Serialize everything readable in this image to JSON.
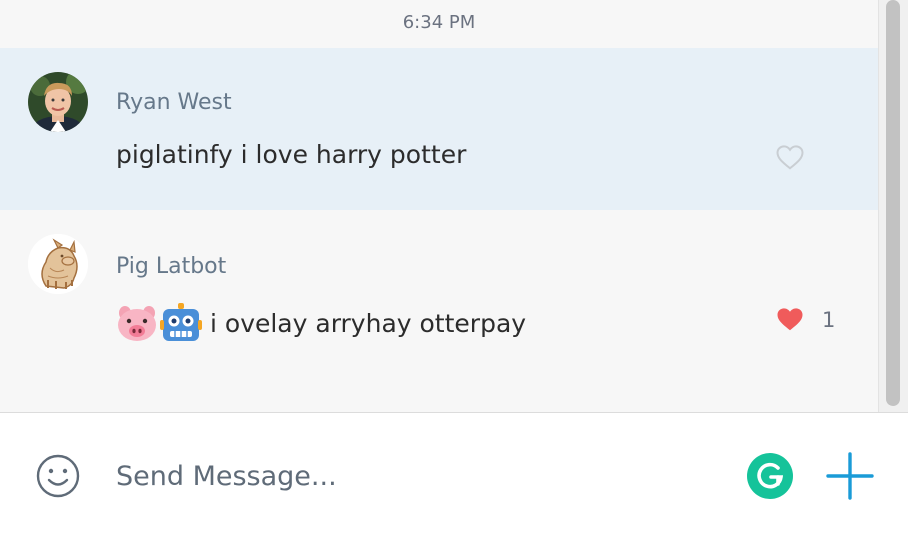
{
  "chat": {
    "timestamp": "6:34 PM",
    "messages": [
      {
        "author": "Ryan West",
        "text": "piglatinfy i love harry potter",
        "liked": false,
        "like_count": ""
      },
      {
        "author": "Pig Latbot",
        "text": "i ovelay arryhay otterpay",
        "emojis": [
          "pig-face-emoji",
          "robot-face-emoji"
        ],
        "liked": true,
        "like_count": "1"
      }
    ]
  },
  "composer": {
    "placeholder": "Send Message..."
  },
  "colors": {
    "highlight_bg": "#e7f0f7",
    "heart_liked": "#f05b5b",
    "accent_plus": "#1a9bd7",
    "grammarly": "#15c39a"
  }
}
